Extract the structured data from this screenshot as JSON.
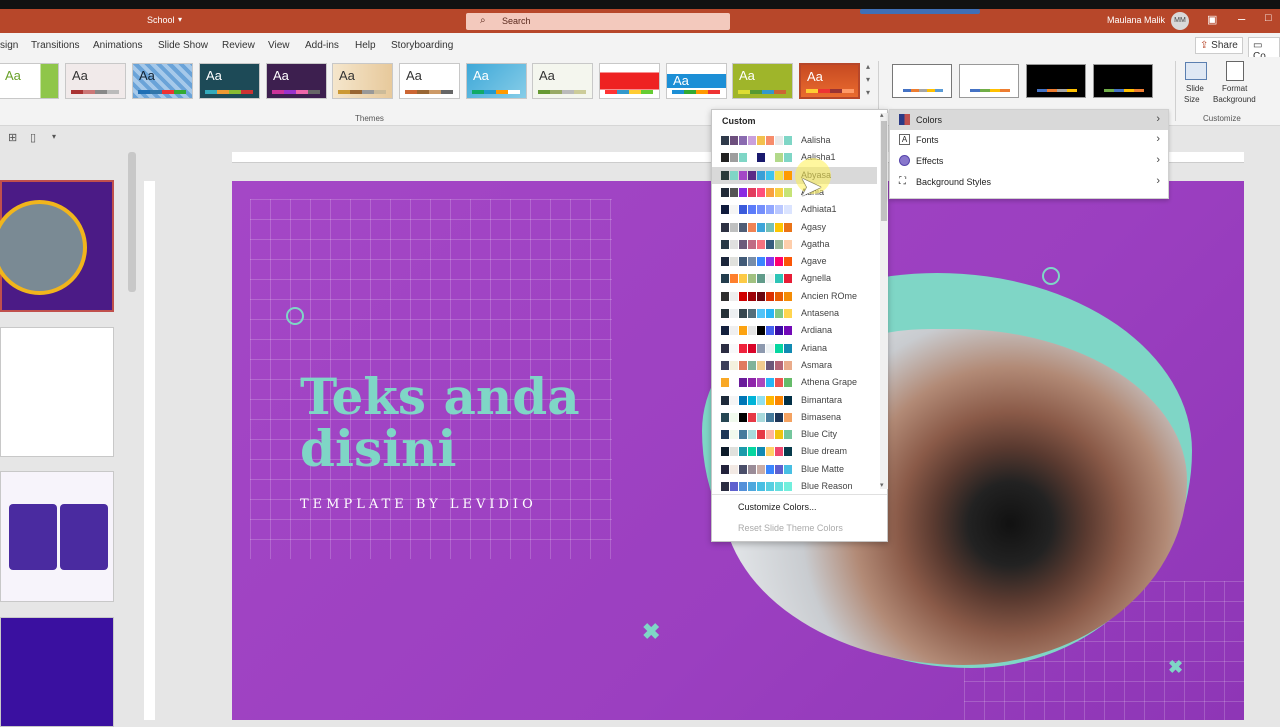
{
  "titlebar": {
    "doc_name": "School",
    "search_placeholder": "Search",
    "user_name": "Maulana Malik",
    "user_initials": "MM"
  },
  "tabs": [
    "sign",
    "Transitions",
    "Animations",
    "Slide Show",
    "Review",
    "View",
    "Add-ins",
    "Help",
    "Storyboarding"
  ],
  "share_label": "Share",
  "comments_label": "Co",
  "ribbon": {
    "themes_group": "Themes",
    "customize_group": "Customize",
    "slide_size_l1": "Slide",
    "slide_size_l2": "Size",
    "format_bg_l1": "Format",
    "format_bg_l2": "Background",
    "theme_label": "Aa"
  },
  "colors_dropdown": {
    "header": "Custom",
    "items": [
      "Aalisha",
      "Aalisha1",
      "Abyasa",
      "Adhia",
      "Adhiata1",
      "Agasy",
      "Agatha",
      "Agave",
      "Agnella",
      "Ancien ROme",
      "Antasena",
      "Ardiana",
      "Ariana",
      "Asmara",
      "Athena Grape",
      "Bimantara",
      "Bimasena",
      "Blue City",
      "Blue dream",
      "Blue Matte",
      "Blue Reason"
    ],
    "customize": "Customize Colors...",
    "reset": "Reset Slide Theme Colors"
  },
  "variants_menu": {
    "items": [
      "Colors",
      "Fonts",
      "Effects",
      "Background Styles"
    ]
  },
  "slide": {
    "title_line1": "Teks anda",
    "title_line2": "disini",
    "subtitle": "TEMPLATE BY LEVIDIO"
  },
  "colors": {
    "accent": "#b7472a",
    "slide_bg": "#a447c6",
    "teal": "#7fd6c6"
  }
}
